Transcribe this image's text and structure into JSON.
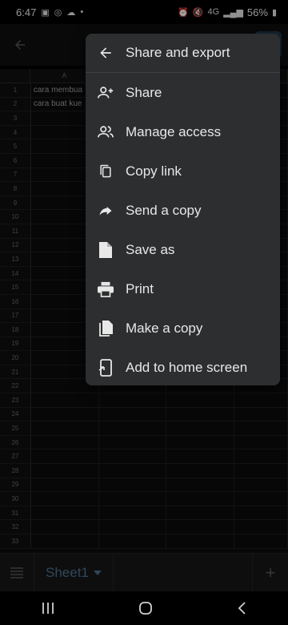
{
  "status_bar": {
    "time": "6:47",
    "battery": "56%",
    "network": "4G"
  },
  "sheet": {
    "column_header": "A",
    "row_numbers": [
      "1",
      "2",
      "3",
      "4",
      "5",
      "6",
      "7",
      "8",
      "9",
      "10",
      "11",
      "12",
      "13",
      "14",
      "15",
      "16",
      "17",
      "18",
      "19",
      "20",
      "21",
      "22",
      "23",
      "24",
      "25",
      "26",
      "27",
      "28",
      "29",
      "30",
      "31",
      "32",
      "33"
    ],
    "cells": {
      "A1": "cara membua",
      "A2": "cara buat kue"
    }
  },
  "bottom_bar": {
    "sheet_tab": "Sheet1",
    "add_label": "+"
  },
  "menu": {
    "title": "Share and export",
    "items": [
      {
        "label": "Share",
        "icon": "person-add-icon"
      },
      {
        "label": "Manage access",
        "icon": "people-icon"
      },
      {
        "label": "Copy link",
        "icon": "copy-icon"
      },
      {
        "label": "Send a copy",
        "icon": "forward-icon"
      },
      {
        "label": "Save as",
        "icon": "file-icon"
      },
      {
        "label": "Print",
        "icon": "print-icon"
      },
      {
        "label": "Make a copy",
        "icon": "file-copy-icon"
      },
      {
        "label": "Add to home screen",
        "icon": "add-to-home-icon"
      }
    ]
  }
}
